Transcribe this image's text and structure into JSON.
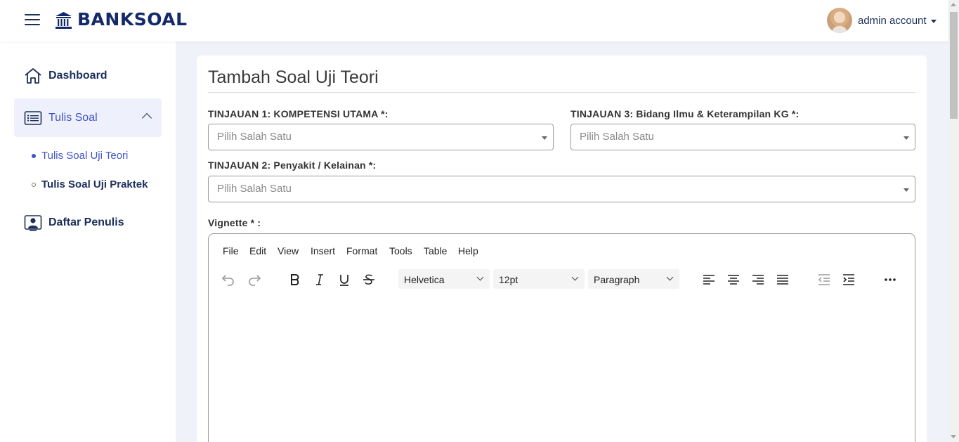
{
  "header": {
    "brand": "BANKSOAL",
    "account_label": "admin account"
  },
  "sidebar": {
    "items": [
      {
        "label": "Dashboard",
        "icon": "home-icon"
      },
      {
        "label": "Tulis Soal",
        "icon": "list-icon",
        "expanded": true
      },
      {
        "label": "Daftar Penulis",
        "icon": "user-id-card-icon"
      }
    ],
    "subitems": [
      {
        "label": "Tulis Soal Uji Teori",
        "active": true
      },
      {
        "label": "Tulis Soal Uji Praktek",
        "active": false
      }
    ]
  },
  "form": {
    "title": "Tambah Soal Uji Teori",
    "field1_label": "TINJAUAN 1: KOMPETENSI UTAMA *:",
    "field3_label": "TINJAUAN 3: Bidang Ilmu & Keterampilan KG *:",
    "field2_label": "TINJAUAN 2: Penyakit / Kelainan *:",
    "select_placeholder": "Pilih Salah Satu",
    "vignette_label": "Vignette * :"
  },
  "editor": {
    "menu": [
      "File",
      "Edit",
      "View",
      "Insert",
      "Format",
      "Tools",
      "Table",
      "Help"
    ],
    "font_family": "Helvetica",
    "font_size": "12pt",
    "block_format": "Paragraph"
  },
  "colors": {
    "brand": "#14296a",
    "nav_text": "#1c2f5a",
    "active_accent": "#4154c8",
    "active_bg": "#eef1fb"
  }
}
